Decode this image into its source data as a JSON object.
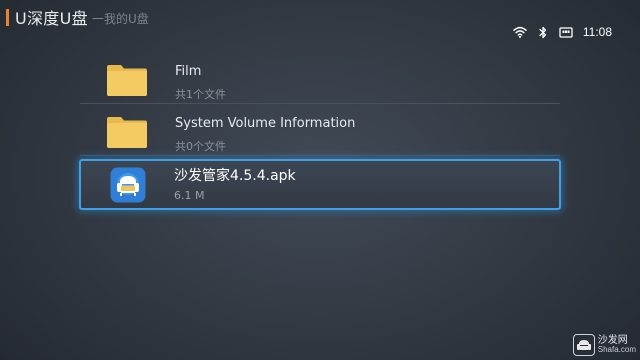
{
  "header": {
    "title": "U深度U盘",
    "subtitle": "一我的U盘"
  },
  "status_bar": {
    "wifi_icon": "wifi-icon",
    "bluetooth_icon": "bluetooth-icon",
    "network_icon": "ethernet-icon",
    "time": "11:08"
  },
  "files": [
    {
      "name": "Film",
      "meta": "共1个文件",
      "icon": "folder-icon"
    },
    {
      "name": "System Volume Information",
      "meta": "共0个文件",
      "icon": "folder-icon"
    },
    {
      "name": "沙发管家4.5.4.apk",
      "meta": "6.1 M",
      "icon": "sofa-app-icon",
      "selected": true
    }
  ],
  "watermark": {
    "cn": "沙发网",
    "en": "Shafa.com"
  },
  "colors": {
    "accent": "#e8862a",
    "selection_border": "#3fa0e6",
    "folder": "#f2c65e",
    "app_icon_bg": "#2f7fd6"
  }
}
